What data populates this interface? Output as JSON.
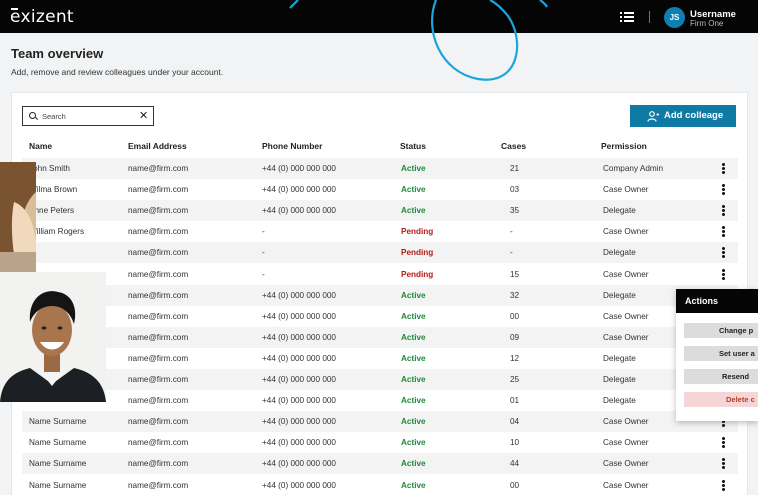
{
  "app": {
    "logo": "exizent"
  },
  "user": {
    "initials": "JS",
    "name": "Username",
    "firm": "Firm One"
  },
  "page": {
    "title": "Team overview",
    "subtitle": "Add, remove and review colleagues under your account."
  },
  "search": {
    "placeholder": "Search",
    "clear": "✕"
  },
  "add_button": {
    "label": "Add colleage"
  },
  "columns": [
    "Name",
    "Email Address",
    "Phone Number",
    "Status",
    "Cases",
    "Permission"
  ],
  "rows": [
    {
      "name": "John Smith",
      "email": "name@firm.com",
      "phone": "+44 (0) 000 000 000",
      "status": "Active",
      "cases": "21",
      "permission": "Company Admin"
    },
    {
      "name": "Wilma Brown",
      "email": "name@firm.com",
      "phone": "+44 (0) 000 000 000",
      "status": "Active",
      "cases": "03",
      "permission": "Case Owner"
    },
    {
      "name": "Anne Peters",
      "email": "name@firm.com",
      "phone": "+44 (0) 000 000 000",
      "status": "Active",
      "cases": "35",
      "permission": "Delegate"
    },
    {
      "name": "William Rogers",
      "email": "name@firm.com",
      "phone": "-",
      "status": "Pending",
      "cases": "-",
      "permission": "Case Owner"
    },
    {
      "name": "",
      "email": "name@firm.com",
      "phone": "-",
      "status": "Pending",
      "cases": "-",
      "permission": "Delegate"
    },
    {
      "name": "",
      "email": "name@firm.com",
      "phone": "-",
      "status": "Pending",
      "cases": "15",
      "permission": "Case Owner"
    },
    {
      "name": "",
      "email": "name@firm.com",
      "phone": "+44 (0) 000 000 000",
      "status": "Active",
      "cases": "32",
      "permission": "Delegate"
    },
    {
      "name": "",
      "email": "name@firm.com",
      "phone": "+44 (0) 000 000 000",
      "status": "Active",
      "cases": "00",
      "permission": "Case Owner"
    },
    {
      "name": "",
      "email": "name@firm.com",
      "phone": "+44 (0) 000 000 000",
      "status": "Active",
      "cases": "09",
      "permission": "Case Owner"
    },
    {
      "name": "",
      "email": "name@firm.com",
      "phone": "+44 (0) 000 000 000",
      "status": "Active",
      "cases": "12",
      "permission": "Delegate"
    },
    {
      "name": "",
      "email": "name@firm.com",
      "phone": "+44 (0) 000 000 000",
      "status": "Active",
      "cases": "25",
      "permission": "Delegate"
    },
    {
      "name": "",
      "email": "name@firm.com",
      "phone": "+44 (0) 000 000 000",
      "status": "Active",
      "cases": "01",
      "permission": "Delegate"
    },
    {
      "name": "Name Surname",
      "email": "name@firm.com",
      "phone": "+44 (0) 000 000 000",
      "status": "Active",
      "cases": "04",
      "permission": "Case Owner"
    },
    {
      "name": "Name Surname",
      "email": "name@firm.com",
      "phone": "+44 (0) 000 000 000",
      "status": "Active",
      "cases": "10",
      "permission": "Case Owner"
    },
    {
      "name": "Name Surname",
      "email": "name@firm.com",
      "phone": "+44 (0) 000 000 000",
      "status": "Active",
      "cases": "44",
      "permission": "Case Owner"
    },
    {
      "name": "Name Surname",
      "email": "name@firm.com",
      "phone": "+44 (0) 000 000 000",
      "status": "Active",
      "cases": "00",
      "permission": "Case Owner"
    }
  ],
  "actions_menu": {
    "title": "Actions",
    "items": [
      "Change p",
      "Set user a",
      "Resend",
      "Delete c"
    ]
  },
  "colors": {
    "accent": "#0f7ba5",
    "active": "#1e8a3a",
    "pending": "#b51a1a",
    "topbar": "#050505"
  }
}
